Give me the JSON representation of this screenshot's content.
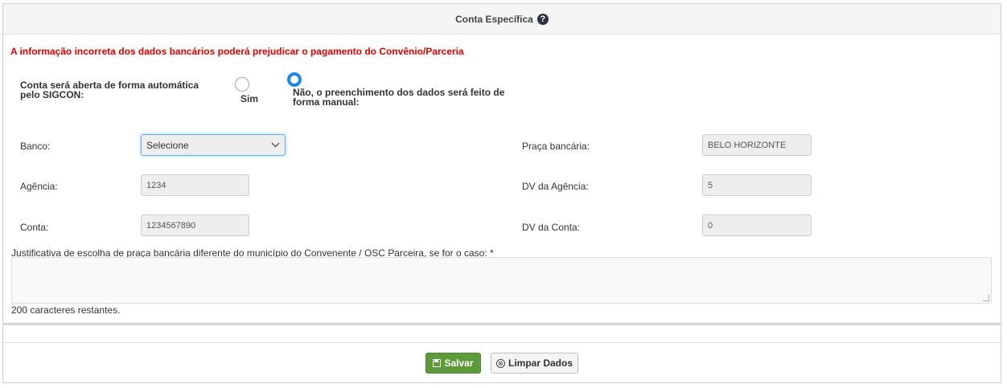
{
  "panel": {
    "title": "Conta Específica",
    "help_icon": "?",
    "warning": "A informação incorreta dos dados bancários poderá prejudicar o pagamento do Convênio/Parceria"
  },
  "account_mode": {
    "question": "Conta será aberta de forma automática pelo SIGCON:",
    "option_yes": "Sim",
    "option_no": "Não, o preenchimento dos dados será feito de forma manual:",
    "selected": "no"
  },
  "fields": {
    "banco_label": "Banco:",
    "banco_value": "Selecione",
    "praca_label": "Praça bancária:",
    "praca_value": "BELO HORIZONTE",
    "agencia_label": "Agência:",
    "agencia_value": "1234",
    "dv_agencia_label": "DV da Agência:",
    "dv_agencia_value": "5",
    "conta_label": "Conta:",
    "conta_value": "1234567890",
    "dv_conta_label": "DV da Conta:",
    "dv_conta_value": "0"
  },
  "justification": {
    "label": "Justificativa de escolha de praça bancária diferente do município do Convenente / OSC Parceira, se for o caso: *",
    "value": "",
    "remaining": "200 caracteres restantes."
  },
  "actions": {
    "save_label": "Salvar",
    "clear_label": "Limpar Dados",
    "clear_icon": "⊗"
  },
  "colors": {
    "warning": "#e60000",
    "save_button": "#5b9b3a",
    "radio_selected": "#1e88e5"
  }
}
